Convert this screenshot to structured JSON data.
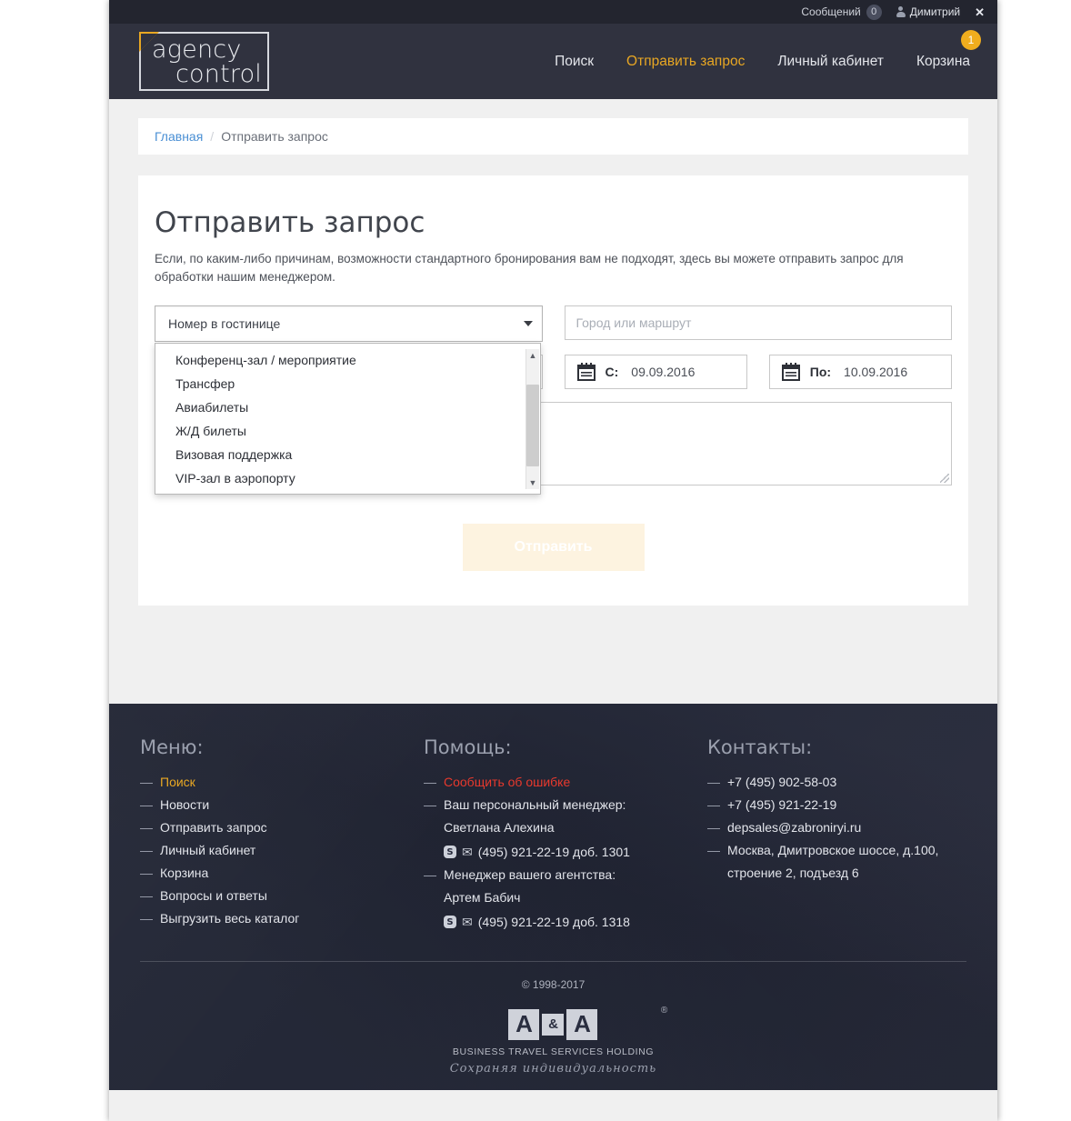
{
  "topbar": {
    "messages_label": "Сообщений",
    "messages_count": "0",
    "user_name": "Димитрий",
    "close_label": "✕"
  },
  "header": {
    "logo_line1": "agency",
    "logo_line2": "control",
    "nav": [
      {
        "label": "Поиск",
        "active": false
      },
      {
        "label": "Отправить запрос",
        "active": true
      },
      {
        "label": "Личный кабинет",
        "active": false
      },
      {
        "label": "Корзина",
        "active": false,
        "badge": "1"
      }
    ],
    "cart_badge": "1",
    "accent_color": "#e8a723"
  },
  "breadcrumb": {
    "home": "Главная",
    "separator": "/",
    "current": "Отправить запрос"
  },
  "main": {
    "title": "Отправить запрос",
    "lead": "Если, по каким-либо причинам, возможности стандартного бронирования вам не подходят, здесь вы можете отправить запрос для обработки нашим менеджером.",
    "service_select": {
      "value": "Номер в гостинице",
      "options": [
        "Конференц-зал / мероприятие",
        "Трансфер",
        "Авиабилеты",
        "Ж/Д билеты",
        "Визовая поддержка",
        "VIP-зал в аэропорту"
      ]
    },
    "city_input": {
      "placeholder": "Город или маршрут",
      "value": ""
    },
    "date_from": {
      "label": "С:",
      "value": "09.09.2016"
    },
    "date_to": {
      "label": "По:",
      "value": "10.09.2016"
    },
    "comment": {
      "value": "",
      "placeholder": ""
    },
    "submit_label": "Отправить"
  },
  "footer": {
    "menu": {
      "heading": "Меню:",
      "items": [
        {
          "label": "Поиск",
          "highlight": "gold"
        },
        {
          "label": "Новости",
          "highlight": ""
        },
        {
          "label": "Отправить запрос",
          "highlight": ""
        },
        {
          "label": "Личный кабинет",
          "highlight": ""
        },
        {
          "label": "Корзина",
          "highlight": ""
        },
        {
          "label": "Вопросы и ответы",
          "highlight": ""
        },
        {
          "label": "Выгрузить весь каталог",
          "highlight": ""
        }
      ]
    },
    "help": {
      "heading": "Помощь:",
      "report_error": "Сообщить об ошибке",
      "personal_manager_label": "Ваш персональный менеджер:",
      "personal_manager_name": "Светлана Алехина",
      "personal_manager_phone": "(495) 921-22-19 доб. 1301",
      "agency_manager_label": "Менеджер вашего агентства:",
      "agency_manager_name": "Артем Бабич",
      "agency_manager_phone": "(495) 921-22-19 доб. 1318"
    },
    "contacts": {
      "heading": "Контакты:",
      "items": [
        "+7 (495) 902-58-03",
        "+7 (495) 921-22-19",
        "depsales@zabroniryi.ru"
      ],
      "address_line1": "Москва, Дмитровское шоссе, д.100,",
      "address_line2": "строение 2, подъезд 6"
    },
    "copyright": "© 1998-2017",
    "brand": {
      "a1": "A",
      "amp": "&",
      "a2": "A",
      "registered": "®",
      "subtitle": "BUSINESS TRAVEL SERVICES HOLDING",
      "tagline": "Сохраняя  индивидуальность"
    }
  }
}
